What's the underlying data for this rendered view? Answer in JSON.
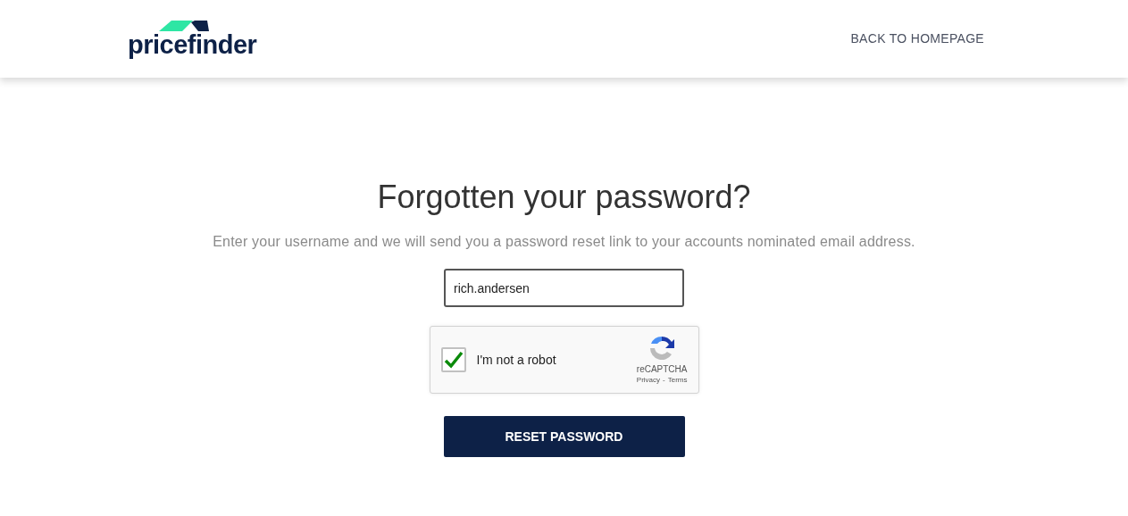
{
  "header": {
    "logo": "pricefinder",
    "back_link": "BACK TO HOMEPAGE"
  },
  "title": "Forgotten your password?",
  "subtitle": "Enter your username and we will send you a password reset link to your accounts nominated email address.",
  "username": {
    "value": "rich.andersen"
  },
  "captcha": {
    "label": "I'm not a robot",
    "checked": true,
    "brand": "reCAPTCHA",
    "privacy": "Privacy",
    "separator": "-",
    "terms": "Terms"
  },
  "button": "RESET PASSWORD"
}
